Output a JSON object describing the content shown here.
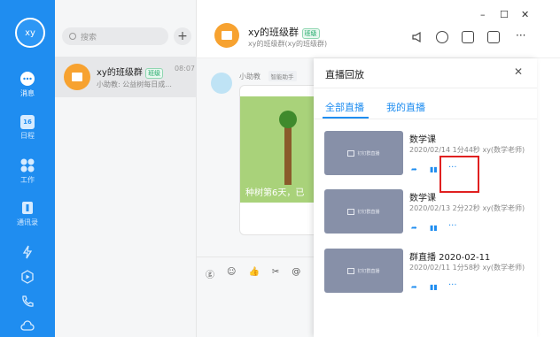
{
  "sidebar": {
    "avatar_text": "xy",
    "items": [
      {
        "label": "消息",
        "icon": "chat-bubble-icon"
      },
      {
        "label": "日程",
        "icon": "calendar-icon",
        "day": "16"
      },
      {
        "label": "工作",
        "icon": "apps-grid-icon"
      },
      {
        "label": "通讯录",
        "icon": "contacts-icon"
      }
    ]
  },
  "conversations": {
    "search_placeholder": "搜索",
    "items": [
      {
        "name": "xy的班级群",
        "badge": "班级",
        "time": "08:07",
        "preview": "小助教: 公益树每日成..."
      }
    ]
  },
  "chat": {
    "title": "xy的班级群",
    "badge": "班级",
    "subtitle": "xy的班级群(xy的班级群)",
    "sender": "小助教",
    "sender_tag": "智能助手",
    "card_text": "种树第6天，已"
  },
  "panel": {
    "title": "直播回放",
    "tabs": [
      "全部直播",
      "我的直播"
    ],
    "thumb_label": "钉钉群直播",
    "records": [
      {
        "title": "数学课",
        "meta": "2020/02/14 1分44秒 xy(数学老师)"
      },
      {
        "title": "数学课",
        "meta": "2020/02/13 2分22秒 xy(数学老师)"
      },
      {
        "title": "群直播 2020-02-11",
        "meta": "2020/02/11 1分58秒 xy(数学老师)"
      }
    ],
    "more_label": "···"
  },
  "colors": {
    "accent": "#1f8df0",
    "group_avatar": "#f7a230",
    "highlight": "#e02020"
  }
}
